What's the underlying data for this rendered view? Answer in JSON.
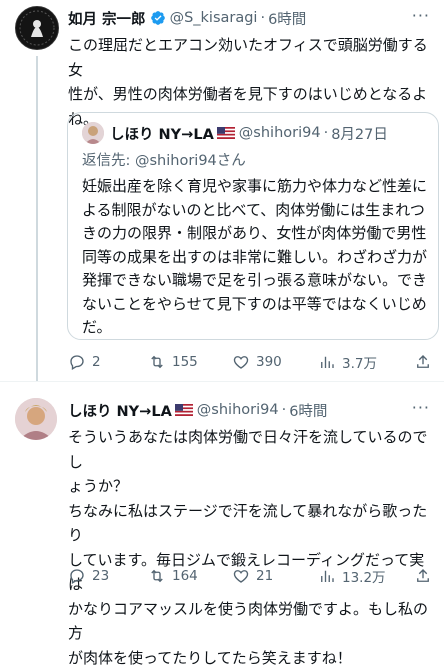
{
  "tweet1": {
    "name": "如月 宗一郎",
    "handle": "@S_kisaragi",
    "time": "6時間",
    "text": "この理屈だとエアコン効いたオフィスで頭脳労働する女\n性が、男性の肉体労働者を見下すのはいじめとなるよ\nね。",
    "actions": {
      "replies": "2",
      "retweets": "155",
      "likes": "390",
      "views": "3.7万"
    }
  },
  "quote": {
    "name": "しほり NY→LA",
    "flag_icon": "us-flag-icon",
    "handle": "@shihori94",
    "date": "8月27日",
    "replying_label": "返信先: ",
    "replying_handle": "@shihori94さん",
    "text": "妊娠出産を除く育児や家事に筋力や体力など性差に\nよる制限がないのと比べて、肉体労働には生まれつ\nきの力の限界・制限があり、女性が肉体労働で男性\n同等の成果を出すのは非常に難しい。わざわざ力が\n発揮できない職場で足を引っ張る意味がない。でき\nないことをやらせて見下すのは平等ではなくいじめ\nだ。"
  },
  "tweet2": {
    "name": "しほり NY→LA",
    "handle": "@shihori94",
    "time": "6時間",
    "text": "そういうあなたは肉体労働で日々汗を流しているのでし\nょうか？\nちなみに私はステージで汗を流して暴れながら歌ったり\nしています。毎日ジムで鍛えレコーディングだって実は\nかなりコアマッスルを使う肉体労働ですよ。もし私の方\nが肉体を使ってたりしてたら笑えますね！",
    "actions": {
      "replies": "23",
      "retweets": "164",
      "likes": "21",
      "views": "13.2万"
    }
  },
  "separator": "·",
  "more_label": "···",
  "colors": {
    "text": "#0f1419",
    "secondary": "#536471",
    "verified": "#1d9bf0",
    "border": "#cfd9de"
  }
}
